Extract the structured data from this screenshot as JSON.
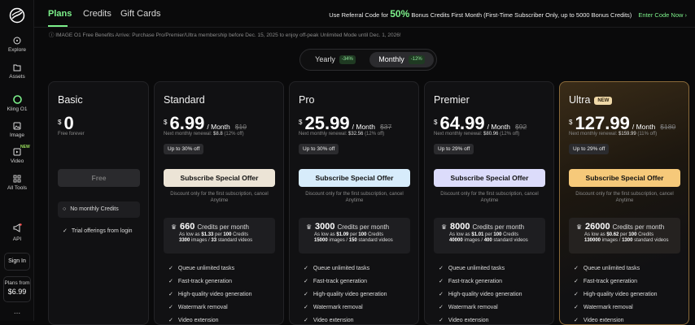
{
  "sidebar": {
    "items": [
      {
        "label": "Explore",
        "icon": "compass-icon"
      },
      {
        "label": "Assets",
        "icon": "folder-icon"
      },
      {
        "label": "Kling O1",
        "icon": "kling-o1-icon"
      },
      {
        "label": "Image",
        "icon": "image-icon"
      },
      {
        "label": "Video",
        "icon": "video-icon",
        "badge": "NEW"
      },
      {
        "label": "All Tools",
        "icon": "grid-icon"
      },
      {
        "label": "API",
        "icon": "megaphone-icon"
      }
    ],
    "sign_in": "Sign In",
    "plans_from_label": "Plans from",
    "plans_from_price": "$6.99",
    "more": "..."
  },
  "tabs": [
    "Plans",
    "Credits",
    "Gift Cards"
  ],
  "referral": {
    "pre": "Use Referral Code for",
    "big": "50%",
    "post": "Bonus Credits First Month (First-Time Subscriber Only, up to 5000 Bonus Credits)",
    "cta": "Enter Code Now ›"
  },
  "notice": "ⓘ IMAGE O1 Free Benefits Arrive: Purchase Pro/Premier/Ultra membership before Dec. 15, 2025 to enjoy off-peak Unlimited Mode until Dec. 1, 2026!",
  "billing_toggle": {
    "yearly": "Yearly",
    "yearly_discount": "-34%",
    "monthly": "Monthly",
    "monthly_discount": "-12%"
  },
  "basic": {
    "name": "Basic",
    "currency": "$",
    "price": "0",
    "sub": "Free forever",
    "button": "Free",
    "no_credits": "No monthly Credits",
    "trial": "Trial offerings from login"
  },
  "plans": [
    {
      "name": "Standard",
      "currency": "$",
      "price": "6.99",
      "per": "/ Month",
      "old": "$10",
      "renew_label": "Next monthly renewal:",
      "renew_price": "$8.8",
      "renew_off": "(12% off)",
      "upto": "Up to 30% off",
      "button": "Subscribe Special Offer",
      "fine": "Discount only for the first subscription, cancel Anytime",
      "credits": "660",
      "credits_unit": "Credits per month",
      "as_low": "As low as",
      "per_credit": "$1.33",
      "per_credit_unit": "per",
      "per_credit_qty": "100",
      "per_credit_tail": "Credits",
      "images": "3300",
      "images_label": "images /",
      "videos": "33",
      "videos_label": "standard videos",
      "button_color": "#ece4d6"
    },
    {
      "name": "Pro",
      "currency": "$",
      "price": "25.99",
      "per": "/ Month",
      "old": "$37",
      "renew_label": "Next monthly renewal:",
      "renew_price": "$32.56",
      "renew_off": "(12% off)",
      "upto": "Up to 30% off",
      "button": "Subscribe Special Offer",
      "fine": "Discount only for the first subscription, cancel Anytime",
      "credits": "3000",
      "credits_unit": "Credits per month",
      "as_low": "As low as",
      "per_credit": "$1.09",
      "per_credit_unit": "per",
      "per_credit_qty": "100",
      "per_credit_tail": "Credits",
      "images": "15000",
      "images_label": "images /",
      "videos": "150",
      "videos_label": "standard videos",
      "button_color": "#d7ecfb"
    },
    {
      "name": "Premier",
      "currency": "$",
      "price": "64.99",
      "per": "/ Month",
      "old": "$92",
      "renew_label": "Next monthly renewal:",
      "renew_price": "$80.96",
      "renew_off": "(12% off)",
      "upto": "Up to 29% off",
      "button": "Subscribe Special Offer",
      "fine": "Discount only for the first subscription, cancel Anytime",
      "credits": "8000",
      "credits_unit": "Credits per month",
      "as_low": "As low as",
      "per_credit": "$1.01",
      "per_credit_unit": "per",
      "per_credit_qty": "100",
      "per_credit_tail": "Credits",
      "images": "40000",
      "images_label": "images /",
      "videos": "400",
      "videos_label": "standard videos",
      "button_color": "#dcdcfb"
    },
    {
      "name": "Ultra",
      "badge": "NEW",
      "currency": "$",
      "price": "127.99",
      "per": "/ Month",
      "old": "$180",
      "renew_label": "Next monthly renewal:",
      "renew_price": "$159.99",
      "renew_off": "(11% off)",
      "upto": "Up to 29% off",
      "button": "Subscribe Special Offer",
      "fine": "Discount only for the first subscription, cancel Anytime",
      "credits": "26000",
      "credits_unit": "Credits per month",
      "as_low": "As low as",
      "per_credit": "$0.62",
      "per_credit_unit": "per",
      "per_credit_qty": "100",
      "per_credit_tail": "Credits",
      "images": "130000",
      "images_label": "images /",
      "videos": "1300",
      "videos_label": "standard videos",
      "button_color": "#f6c97a"
    }
  ],
  "features": [
    "Queue unlimited tasks",
    "Fast-track generation",
    "High-quality video generation",
    "Watermark removal",
    "Video extension"
  ],
  "colors": {
    "accent": "#7cf08a",
    "ultra_border": "#8a6a3a",
    "ultra_badge": "#f0d9a8"
  }
}
